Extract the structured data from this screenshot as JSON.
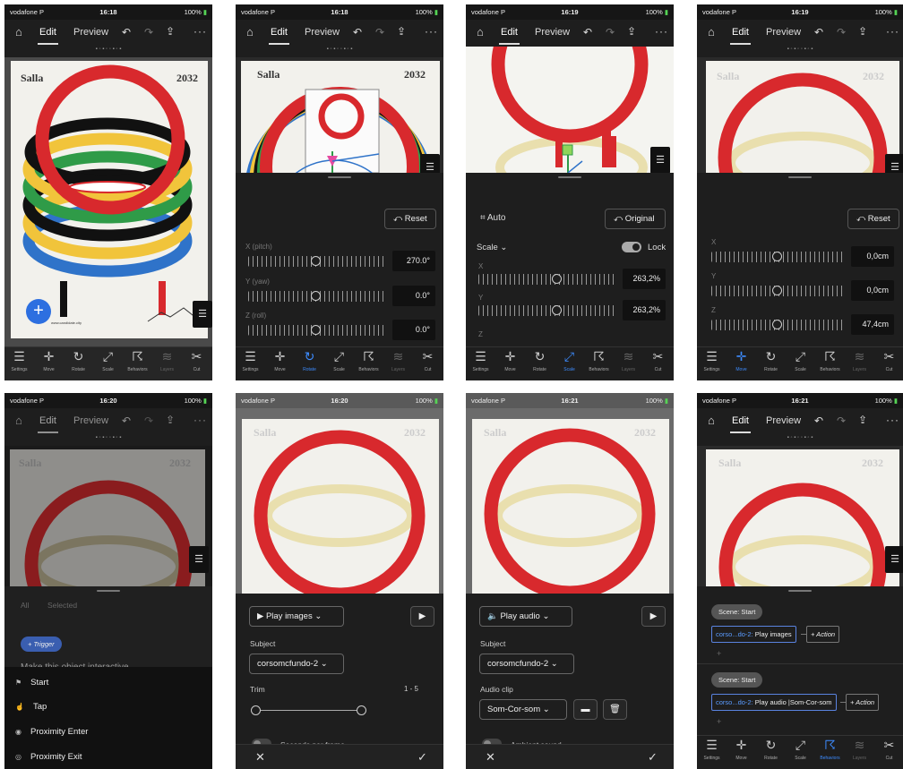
{
  "status": {
    "carrier": "vodafone P",
    "battery": "100%",
    "times": [
      "16:18",
      "16:18",
      "16:19",
      "16:19",
      "16:20",
      "16:20",
      "16:21",
      "16:21"
    ]
  },
  "toolbar": {
    "home": "⌂",
    "edit": "Edit",
    "preview": "Preview",
    "undo": "↶",
    "redo": "↷",
    "share": "⇪",
    "more": "···"
  },
  "poster": {
    "title": "Salla",
    "year": "2032",
    "caption": "www.candidate.city"
  },
  "tabs": [
    {
      "label": "Settings",
      "icon": "settings-icon"
    },
    {
      "label": "Move",
      "icon": "move-icon"
    },
    {
      "label": "Rotate",
      "icon": "rotate-icon"
    },
    {
      "label": "Scale",
      "icon": "scale-icon"
    },
    {
      "label": "Behaviors",
      "icon": "behaviors-icon"
    },
    {
      "label": "Layers",
      "icon": "layers-icon"
    },
    {
      "label": "Cut",
      "icon": "cut-icon"
    }
  ],
  "rotate_panel": {
    "reset": "Reset",
    "x_label": "X (pitch)",
    "x_value": "270.0°",
    "y_label": "Y (yaw)",
    "y_value": "0.0°",
    "z_label": "Z (roll)",
    "z_value": "0.0°"
  },
  "scale_panel": {
    "auto": "Auto",
    "original": "Original",
    "scale_menu": "Scale",
    "lock": "Lock",
    "x_label": "X",
    "x_value": "263,2%",
    "y_label": "Y",
    "y_value": "263,2%",
    "z_label": "Z"
  },
  "move_panel": {
    "reset": "Reset",
    "x_label": "X",
    "x_value": "0,0cm",
    "y_label": "Y",
    "y_value": "0,0cm",
    "z_label": "Z",
    "z_value": "47,4cm"
  },
  "trigger_panel": {
    "filter_all": "All",
    "filter_selected": "Selected",
    "trigger_button": "+ Trigger",
    "hint": "Make this object interactive",
    "items": [
      "Start",
      "Tap",
      "Proximity Enter",
      "Proximity Exit"
    ]
  },
  "play_images": {
    "action": "Play images",
    "subject_label": "Subject",
    "subject": "corsomcfundo-2",
    "trim_label": "Trim",
    "trim_range": "1 - 5",
    "spf_label": "Seconds per frame",
    "cancel": "✕",
    "confirm": "✓"
  },
  "play_audio": {
    "action": "Play audio",
    "subject_label": "Subject",
    "subject": "corsomcfundo-2",
    "clip_label": "Audio clip",
    "clip": "Som-Cor-som",
    "ambient_label": "Ambient sound",
    "cancel": "✕",
    "confirm": "✓"
  },
  "behaviors": {
    "scene1": "Scene: Start",
    "act1_obj": "corso...do-2:",
    "act1": "Play images",
    "scene2": "Scene: Start",
    "act2_obj": "corso...do-2:",
    "act2": "Play audio |Som-Cor-som",
    "add_action": "+ Action",
    "plus": "+"
  },
  "colors": {
    "red": "#d8292d",
    "blue": "#2f73c9",
    "yellow": "#f1c43b",
    "green": "#2f9b48",
    "black": "#111111",
    "accent": "#3d8cff"
  }
}
